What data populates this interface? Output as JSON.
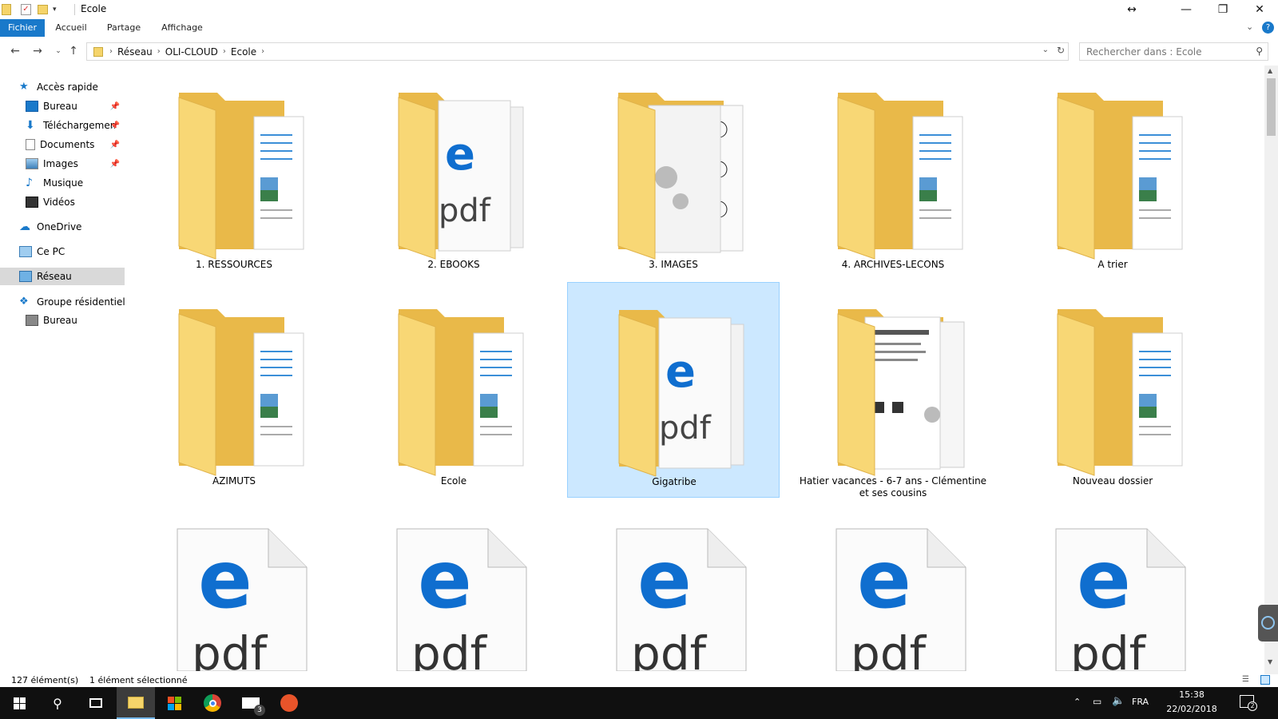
{
  "window": {
    "title": "Ecole"
  },
  "ribbon": {
    "tabs": [
      "Fichier",
      "Accueil",
      "Partage",
      "Affichage"
    ]
  },
  "address": {
    "crumbs": [
      "Réseau",
      "OLI-CLOUD",
      "Ecole"
    ]
  },
  "search": {
    "placeholder": "Rechercher dans : Ecole"
  },
  "sidebar": {
    "quick_access": "Accès rapide",
    "items": [
      "Bureau",
      "Téléchargements",
      "Documents",
      "Images",
      "Musique",
      "Vidéos"
    ],
    "onedrive": "OneDrive",
    "this_pc": "Ce PC",
    "network": "Réseau",
    "homegroup": "Groupe résidentiel",
    "homegroup_child": "Bureau"
  },
  "files": {
    "row1": [
      "1. RESSOURCES",
      "2. EBOOKS",
      "3. IMAGES",
      "4. ARCHIVES-LECONS",
      "A trier"
    ],
    "row2": [
      "AZIMUTS",
      "Ecole",
      "Gigatribe",
      "Hatier vacances - 6-7 ans - Clémentine et ses cousins",
      "Nouveau dossier"
    ],
    "pdf_text": "pdf",
    "pdf_letter": "e"
  },
  "status": {
    "count": "127 élément(s)",
    "selected": "1 élément sélectionné"
  },
  "taskbar": {
    "lang": "FRA",
    "time": "15:38",
    "date": "22/02/2018",
    "mail_badge": "3",
    "notif_badge": "2"
  },
  "colors": {
    "accent": "#1979ca",
    "folder": "#f8d775",
    "folder_dark": "#e9b949",
    "selection": "#cce8ff",
    "edge_blue": "#0f6ecf"
  }
}
